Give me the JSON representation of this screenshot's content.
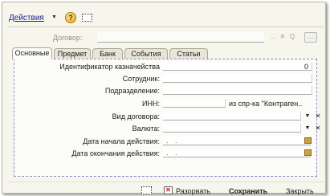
{
  "toolbar": {
    "actions_label": "Действия",
    "actions_caret": "▼",
    "help_label": "?"
  },
  "contract": {
    "label": "Договор:",
    "value": "",
    "select_btn": "...",
    "clear_btn": "✕",
    "search_btn": "Q",
    "open_btn": "..."
  },
  "tabs": [
    {
      "label": "Основные",
      "active": true
    },
    {
      "label": "Предмет",
      "active": false
    },
    {
      "label": "Банк",
      "active": false
    },
    {
      "label": "События",
      "active": false
    },
    {
      "label": "Статьи",
      "active": false
    }
  ],
  "form": {
    "treasury_id": {
      "label": "Идентификатор казначейства",
      "value": "0"
    },
    "employee": {
      "label": "Сотрудник:",
      "value": ""
    },
    "department": {
      "label": "Подразделение:",
      "value": ""
    },
    "inn": {
      "label": "ИНН:",
      "value": "",
      "hint": "из спр-ка \"Контраген.."
    },
    "contract_type": {
      "label": "Вид договора:",
      "value": "",
      "dropdown": "▼",
      "clear": "✕"
    },
    "currency": {
      "label": "Валюта:",
      "value": "",
      "dropdown": "▼",
      "clear": "✕"
    },
    "start_date": {
      "label": "Дата начала действия:",
      "value": ". ."
    },
    "end_date": {
      "label": "Дата окончания действия:",
      "value": ". ."
    }
  },
  "footer": {
    "break_label": "Разорвать",
    "save_label": "Сохранить",
    "close_label": "Закрыть"
  },
  "colors": {
    "window_bg": "#f7f6ed",
    "link": "#1c1c8c",
    "panel_border": "#8d8cc8"
  }
}
